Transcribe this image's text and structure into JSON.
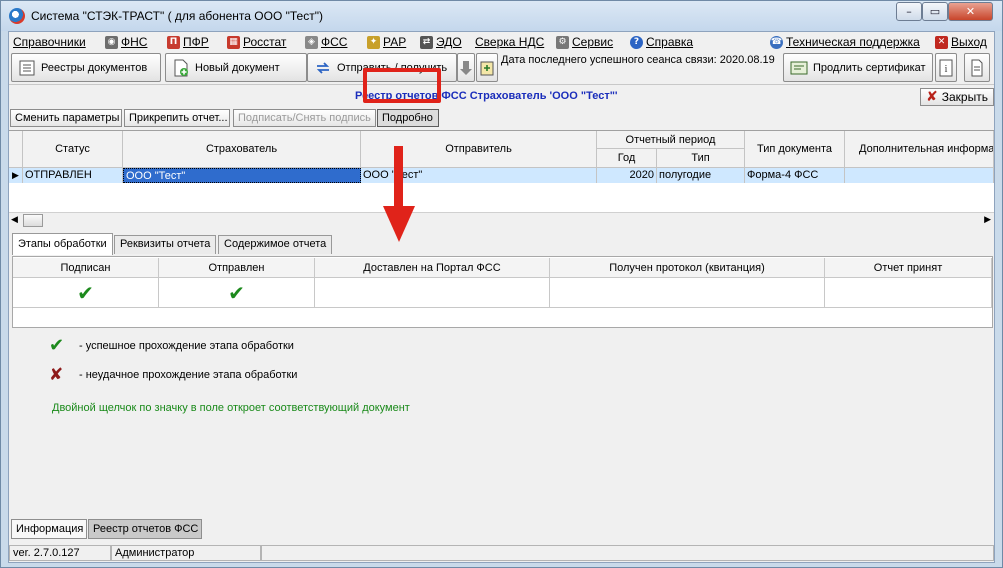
{
  "window": {
    "title": "Система \"СТЭК-ТРАСТ\" ( для абонента ООО \"Тест\")",
    "controls": {
      "minimize": "–",
      "maximize": "▭",
      "close": "✕"
    }
  },
  "menu": {
    "items": [
      {
        "label": "Справочники",
        "icon": "none"
      },
      {
        "label": "ФНС",
        "icon": "fns-icon"
      },
      {
        "label": "ПФР",
        "icon": "pfr-icon"
      },
      {
        "label": "Росстат",
        "icon": "rosstat-icon"
      },
      {
        "label": "ФСС",
        "icon": "fss-icon"
      },
      {
        "label": "РАР",
        "icon": "rar-icon"
      },
      {
        "label": "ЭДО",
        "icon": "edo-icon"
      },
      {
        "label": "Сверка НДС",
        "icon": "none"
      },
      {
        "label": "Сервис",
        "icon": "gear-icon"
      },
      {
        "label": "Справка",
        "icon": "help-icon"
      }
    ],
    "support": "Техническая поддержка",
    "exit": "Выход"
  },
  "toolbar": {
    "registries": "Реестры документов",
    "new_document": "Новый документ",
    "send_receive": "Отправить / получить",
    "last_session": "Дата последнего успешного сеанса связи: 2020.08.19",
    "extend_certificate": "Продлить сертификат"
  },
  "report": {
    "title": "Реестр отчетов ФСС  Страхователь 'ООО \"Тест\"'",
    "close": "Закрыть"
  },
  "actions": {
    "change_params": "Сменить параметры",
    "attach_report": "Прикрепить отчет...",
    "sign_unsign": "Подписать/Снять подпись",
    "details": "Подробно"
  },
  "grid": {
    "headers": {
      "status": "Статус",
      "insurer": "Страхователь",
      "sender": "Отправитель",
      "period": "Отчетный период",
      "year": "Год",
      "type": "Тип",
      "doc_type": "Тип документа",
      "extra": "Дополнительная информация"
    },
    "row": {
      "status": "ОТПРАВЛЕН",
      "insurer": "ООО \"Тест\"",
      "sender": "ООО \"Тест\"",
      "year": "2020",
      "type": "полугодие",
      "doc_type": "Форма-4 ФСС",
      "extra": ""
    }
  },
  "tabs": [
    {
      "label": "Этапы обработки",
      "active": true
    },
    {
      "label": "Реквизиты отчета",
      "active": false
    },
    {
      "label": "Содержимое отчета",
      "active": false
    }
  ],
  "stages": {
    "headers": [
      "Подписан",
      "Отправлен",
      "Доставлен на Портал ФСС",
      "Получен протокол (квитанция)",
      "Отчет принят"
    ],
    "values": [
      "✔",
      "✔",
      "",
      "",
      ""
    ]
  },
  "legend": {
    "success_mark": "✔",
    "success_text": "-  успешное прохождение этапа обработки",
    "fail_mark": "✘",
    "fail_text": "-  неудачное прохождение этапа обработки",
    "hint": "Двойной щелчок по значку в поле откроет соответствующий документ"
  },
  "bottom_tabs": [
    {
      "label": "Информация",
      "active": false
    },
    {
      "label": "Реестр отчетов ФСС",
      "active": true
    }
  ],
  "status": {
    "version": "ver. 2.7.0.127",
    "user": "Администратор"
  },
  "colors": {
    "highlight": "#e0231a",
    "selection": "#2f6ccd",
    "title_blue": "#1a2dbb",
    "hint_green": "#1a8a1a"
  }
}
